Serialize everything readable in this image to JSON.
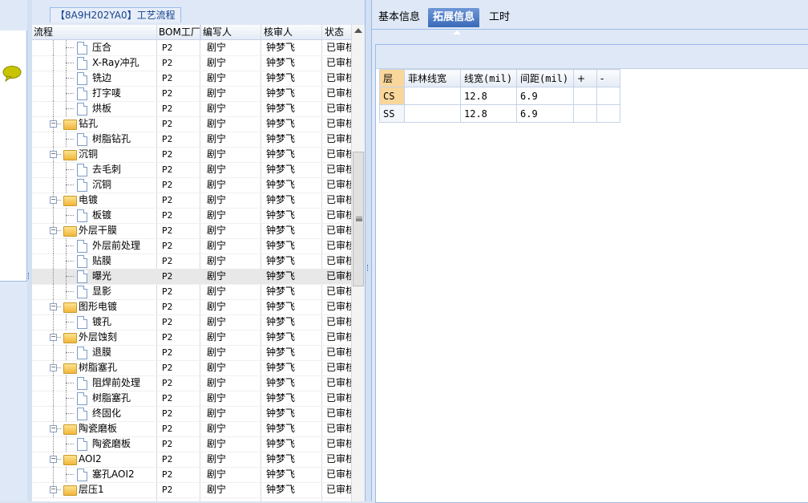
{
  "panel_title": "【8A9H202YA0】工艺流程",
  "columns": {
    "flow": "流程",
    "bom": "BOM工厂",
    "author": "编写人",
    "reviewer": "核审人",
    "status": "状态"
  },
  "rows": [
    {
      "label": "压合",
      "type": "leaf",
      "depth": 1,
      "bom": "P2",
      "author": "剧宁",
      "reviewer": "钟梦飞",
      "status": "已审核"
    },
    {
      "label": "X-Ray冲孔",
      "type": "leaf",
      "depth": 1,
      "bom": "P2",
      "author": "剧宁",
      "reviewer": "钟梦飞",
      "status": "已审核"
    },
    {
      "label": "铣边",
      "type": "leaf",
      "depth": 1,
      "bom": "P2",
      "author": "剧宁",
      "reviewer": "钟梦飞",
      "status": "已审核"
    },
    {
      "label": "打字唛",
      "type": "leaf",
      "depth": 1,
      "bom": "P2",
      "author": "剧宁",
      "reviewer": "钟梦飞",
      "status": "已审核"
    },
    {
      "label": "烘板",
      "type": "leaf",
      "depth": 1,
      "bom": "P2",
      "author": "剧宁",
      "reviewer": "钟梦飞",
      "status": "已审核"
    },
    {
      "label": "钻孔",
      "type": "folder",
      "depth": 0,
      "bom": "P2",
      "author": "剧宁",
      "reviewer": "钟梦飞",
      "status": "已审核"
    },
    {
      "label": "树脂钻孔",
      "type": "leaf",
      "depth": 1,
      "bom": "P2",
      "author": "剧宁",
      "reviewer": "钟梦飞",
      "status": "已审核"
    },
    {
      "label": "沉铜",
      "type": "folder",
      "depth": 0,
      "bom": "P2",
      "author": "剧宁",
      "reviewer": "钟梦飞",
      "status": "已审核"
    },
    {
      "label": "去毛刺",
      "type": "leaf",
      "depth": 1,
      "bom": "P2",
      "author": "剧宁",
      "reviewer": "钟梦飞",
      "status": "已审核"
    },
    {
      "label": "沉铜",
      "type": "leaf",
      "depth": 1,
      "bom": "P2",
      "author": "剧宁",
      "reviewer": "钟梦飞",
      "status": "已审核"
    },
    {
      "label": "电镀",
      "type": "folder",
      "depth": 0,
      "bom": "P2",
      "author": "剧宁",
      "reviewer": "钟梦飞",
      "status": "已审核"
    },
    {
      "label": "板镀",
      "type": "leaf",
      "depth": 1,
      "bom": "P2",
      "author": "剧宁",
      "reviewer": "钟梦飞",
      "status": "已审核"
    },
    {
      "label": "外层干膜",
      "type": "folder",
      "depth": 0,
      "bom": "P2",
      "author": "剧宁",
      "reviewer": "钟梦飞",
      "status": "已审核"
    },
    {
      "label": "外层前处理",
      "type": "leaf",
      "depth": 1,
      "bom": "P2",
      "author": "剧宁",
      "reviewer": "钟梦飞",
      "status": "已审核"
    },
    {
      "label": "贴膜",
      "type": "leaf",
      "depth": 1,
      "bom": "P2",
      "author": "剧宁",
      "reviewer": "钟梦飞",
      "status": "已审核"
    },
    {
      "label": "曝光",
      "type": "leaf",
      "depth": 1,
      "bom": "P2",
      "author": "剧宁",
      "reviewer": "钟梦飞",
      "status": "已审核",
      "selected": true
    },
    {
      "label": "显影",
      "type": "leaf",
      "depth": 1,
      "bom": "P2",
      "author": "剧宁",
      "reviewer": "钟梦飞",
      "status": "已审核"
    },
    {
      "label": "图形电镀",
      "type": "folder",
      "depth": 0,
      "bom": "P2",
      "author": "剧宁",
      "reviewer": "钟梦飞",
      "status": "已审核"
    },
    {
      "label": "镀孔",
      "type": "leaf",
      "depth": 1,
      "bom": "P2",
      "author": "剧宁",
      "reviewer": "钟梦飞",
      "status": "已审核"
    },
    {
      "label": "外层蚀刻",
      "type": "folder",
      "depth": 0,
      "bom": "P2",
      "author": "剧宁",
      "reviewer": "钟梦飞",
      "status": "已审核"
    },
    {
      "label": "退膜",
      "type": "leaf",
      "depth": 1,
      "bom": "P2",
      "author": "剧宁",
      "reviewer": "钟梦飞",
      "status": "已审核"
    },
    {
      "label": "树脂塞孔",
      "type": "folder",
      "depth": 0,
      "bom": "P2",
      "author": "剧宁",
      "reviewer": "钟梦飞",
      "status": "已审核"
    },
    {
      "label": "阻焊前处理",
      "type": "leaf",
      "depth": 1,
      "bom": "P2",
      "author": "剧宁",
      "reviewer": "钟梦飞",
      "status": "已审核"
    },
    {
      "label": "树脂塞孔",
      "type": "leaf",
      "depth": 1,
      "bom": "P2",
      "author": "剧宁",
      "reviewer": "钟梦飞",
      "status": "已审核"
    },
    {
      "label": "终固化",
      "type": "leaf",
      "depth": 1,
      "bom": "P2",
      "author": "剧宁",
      "reviewer": "钟梦飞",
      "status": "已审核"
    },
    {
      "label": "陶瓷磨板",
      "type": "folder",
      "depth": 0,
      "bom": "P2",
      "author": "剧宁",
      "reviewer": "钟梦飞",
      "status": "已审核"
    },
    {
      "label": "陶瓷磨板",
      "type": "leaf",
      "depth": 1,
      "bom": "P2",
      "author": "剧宁",
      "reviewer": "钟梦飞",
      "status": "已审核"
    },
    {
      "label": "AOI2",
      "type": "folder",
      "depth": 0,
      "bom": "P2",
      "author": "剧宁",
      "reviewer": "钟梦飞",
      "status": "已审核"
    },
    {
      "label": "塞孔AOI2",
      "type": "leaf",
      "depth": 1,
      "bom": "P2",
      "author": "剧宁",
      "reviewer": "钟梦飞",
      "status": "已审核"
    },
    {
      "label": "层压1",
      "type": "folder",
      "depth": 0,
      "bom": "P2",
      "author": "剧宁",
      "reviewer": "钟梦飞",
      "status": "已审核"
    }
  ],
  "tabs": [
    {
      "label": "基本信息",
      "active": false
    },
    {
      "label": "拓展信息",
      "active": true
    },
    {
      "label": "工时",
      "active": false
    }
  ],
  "ext_table": {
    "headers": [
      "层",
      "菲林线宽",
      "线宽(mil)",
      "间距(mil)",
      "+",
      "-"
    ],
    "rows": [
      {
        "layer": "CS",
        "film_width": "",
        "line_width": "12.8",
        "spacing": "6.9",
        "selected": true
      },
      {
        "layer": "SS",
        "film_width": "",
        "line_width": "12.8",
        "spacing": "6.9",
        "selected": false
      }
    ]
  },
  "colors": {
    "accent": "#3b6ab8",
    "header_bg": "#dfe8f6",
    "selected_cell": "#f9d79b",
    "folder": "#f2b63c"
  },
  "icons": {
    "chat": "speech-bubble-icon",
    "folder": "folder-icon",
    "document": "document-icon",
    "collapse": "minus-box-icon"
  }
}
